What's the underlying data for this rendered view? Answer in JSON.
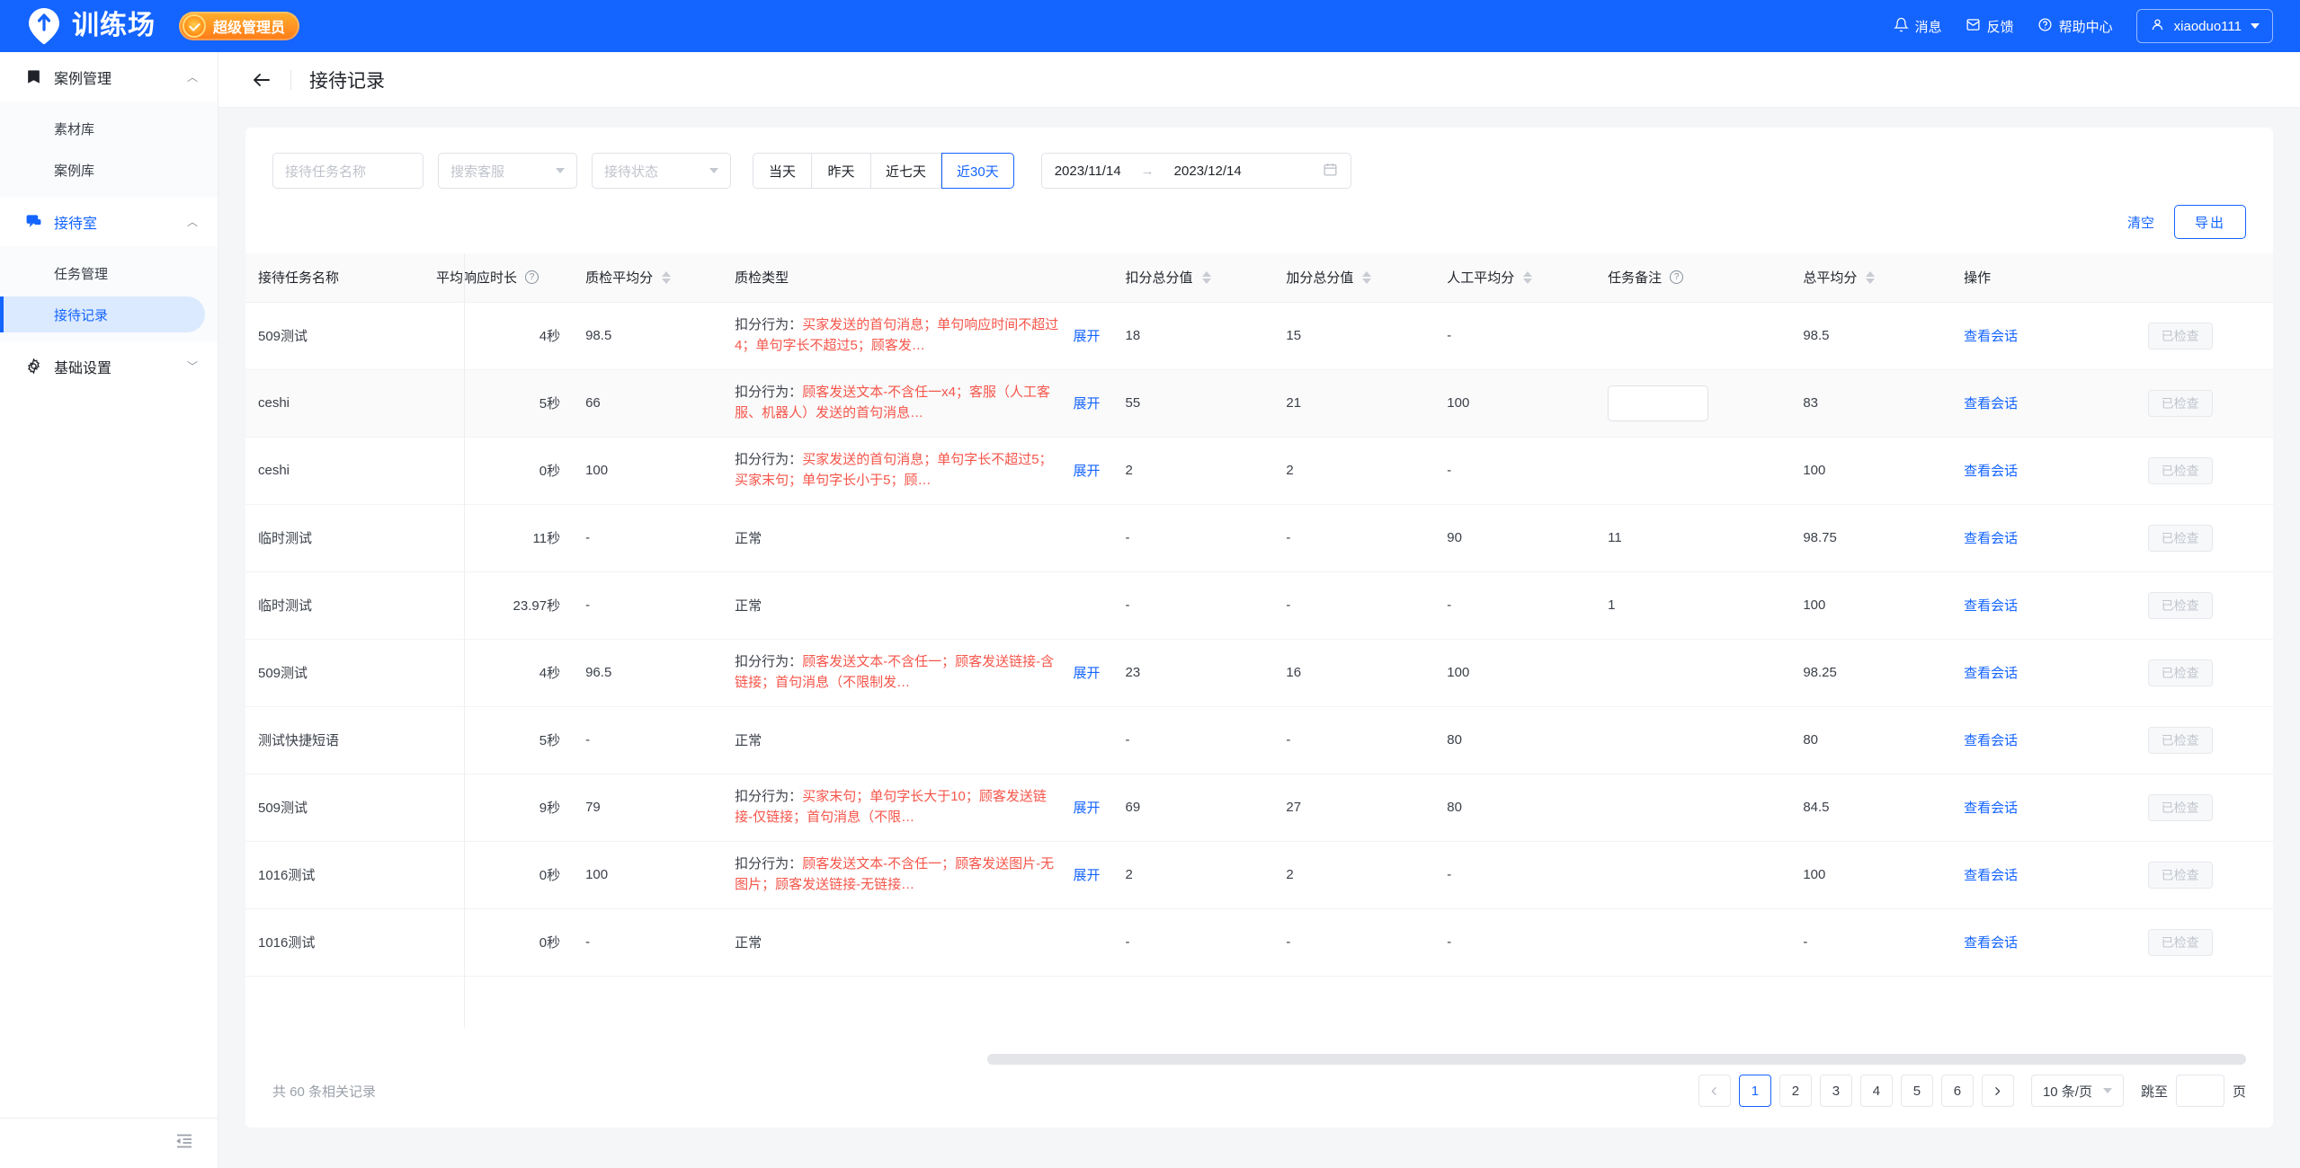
{
  "brand": {
    "name": "训练场",
    "badge_label": "超级管理员",
    "accent": "#1464ff"
  },
  "topnav": {
    "items": [
      {
        "label": "消息",
        "icon": "bell-icon"
      },
      {
        "label": "反馈",
        "icon": "feedback-icon"
      },
      {
        "label": "帮助中心",
        "icon": "help-circle-icon"
      }
    ],
    "user": "xiaoduo111"
  },
  "sidebar": {
    "groups": [
      {
        "label": "案例管理",
        "icon": "book-icon",
        "expanded": true,
        "active": false,
        "chevron": "︿",
        "items": [
          {
            "label": "素材库",
            "selected": false
          },
          {
            "label": "案例库",
            "selected": false
          }
        ]
      },
      {
        "label": "接待室",
        "icon": "chat-icon",
        "expanded": true,
        "active": true,
        "chevron": "︿",
        "items": [
          {
            "label": "任务管理",
            "selected": false
          },
          {
            "label": "接待记录",
            "selected": true
          }
        ]
      },
      {
        "label": "基础设置",
        "icon": "gear-icon",
        "expanded": false,
        "active": false,
        "chevron": "﹀",
        "items": []
      }
    ],
    "collapse_icon": "collapse-menu-icon"
  },
  "header": {
    "back_icon": "back-arrow-icon",
    "title": "接待记录"
  },
  "filters": {
    "task_name_placeholder": "接待任务名称",
    "task_name_value": "",
    "agent_select_placeholder": "搜索客服",
    "agent_select_value": "",
    "status_select_placeholder": "接待状态",
    "status_select_value": "",
    "quick_ranges": [
      {
        "label": "当天",
        "active": false
      },
      {
        "label": "昨天",
        "active": false
      },
      {
        "label": "近七天",
        "active": false
      },
      {
        "label": "近30天",
        "active": true
      }
    ],
    "date_start": "2023/11/14",
    "date_separator": "→",
    "date_end": "2023/12/14",
    "calendar_icon": "calendar-icon"
  },
  "actions": {
    "clear_label": "清空",
    "export_label": "导出"
  },
  "table": {
    "columns": [
      {
        "label": "接待任务名称",
        "sortable": false,
        "help": false
      },
      {
        "label": "平均响应时长",
        "sortable": false,
        "help": true
      },
      {
        "label": "质检平均分",
        "sortable": true,
        "help": false
      },
      {
        "label": "质检类型",
        "sortable": false,
        "help": false
      },
      {
        "label": "扣分总分值",
        "sortable": true,
        "help": false
      },
      {
        "label": "加分总分值",
        "sortable": true,
        "help": false
      },
      {
        "label": "人工平均分",
        "sortable": true,
        "help": false
      },
      {
        "label": "任务备注",
        "sortable": false,
        "help": true
      },
      {
        "label": "总平均分",
        "sortable": true,
        "help": false
      },
      {
        "label": "操作",
        "sortable": false,
        "help": false
      }
    ],
    "expand_label": "展开",
    "qc_prefix": "扣分行为：",
    "normal_label": "正常",
    "view_label": "查看会话",
    "checked_label": "已检查",
    "rows": [
      {
        "task": "509测试",
        "avg_resp": "4秒",
        "qc_avg": "98.5",
        "qc_type_kind": "deduct",
        "qc_detail": "买家发送的首句消息；单句响应时间不超过4；单句字长不超过5；顾客发…",
        "deduct_total": "18",
        "add_total": "15",
        "manual_avg": "-",
        "note": "",
        "note_input": false,
        "total_avg": "98.5",
        "alt": false
      },
      {
        "task": "ceshi",
        "avg_resp": "5秒",
        "qc_avg": "66",
        "qc_type_kind": "deduct",
        "qc_detail": "顾客发送文本-不含任一x4；客服（人工客服、机器人）发送的首句消息…",
        "deduct_total": "55",
        "add_total": "21",
        "manual_avg": "100",
        "note": "",
        "note_input": true,
        "total_avg": "83",
        "alt": true
      },
      {
        "task": "ceshi",
        "avg_resp": "0秒",
        "qc_avg": "100",
        "qc_type_kind": "deduct",
        "qc_detail": "买家发送的首句消息；单句字长不超过5；买家末句；单句字长小于5；顾…",
        "deduct_total": "2",
        "add_total": "2",
        "manual_avg": "-",
        "note": "",
        "note_input": false,
        "total_avg": "100",
        "alt": false
      },
      {
        "task": "临时测试",
        "avg_resp": "11秒",
        "qc_avg": "-",
        "qc_type_kind": "normal",
        "qc_detail": "",
        "deduct_total": "-",
        "add_total": "-",
        "manual_avg": "90",
        "note": "11",
        "note_input": false,
        "total_avg": "98.75",
        "alt": false
      },
      {
        "task": "临时测试",
        "avg_resp": "23.97秒",
        "qc_avg": "-",
        "qc_type_kind": "normal",
        "qc_detail": "",
        "deduct_total": "-",
        "add_total": "-",
        "manual_avg": "-",
        "note": "1",
        "note_input": false,
        "total_avg": "100",
        "alt": false
      },
      {
        "task": "509测试",
        "avg_resp": "4秒",
        "qc_avg": "96.5",
        "qc_type_kind": "deduct",
        "qc_detail": "顾客发送文本-不含任一；顾客发送链接-含链接；首句消息（不限制发…",
        "deduct_total": "23",
        "add_total": "16",
        "manual_avg": "100",
        "note": "",
        "note_input": false,
        "total_avg": "98.25",
        "alt": false
      },
      {
        "task": "测试快捷短语",
        "avg_resp": "5秒",
        "qc_avg": "-",
        "qc_type_kind": "normal",
        "qc_detail": "",
        "deduct_total": "-",
        "add_total": "-",
        "manual_avg": "80",
        "note": "",
        "note_input": false,
        "total_avg": "80",
        "alt": false
      },
      {
        "task": "509测试",
        "avg_resp": "9秒",
        "qc_avg": "79",
        "qc_type_kind": "deduct",
        "qc_detail": "买家末句；单句字长大于10；顾客发送链接-仅链接；首句消息（不限…",
        "deduct_total": "69",
        "add_total": "27",
        "manual_avg": "80",
        "note": "",
        "note_input": false,
        "total_avg": "84.5",
        "alt": false
      },
      {
        "task": "1016测试",
        "avg_resp": "0秒",
        "qc_avg": "100",
        "qc_type_kind": "deduct",
        "qc_detail": "顾客发送文本-不含任一；顾客发送图片-无图片；顾客发送链接-无链接…",
        "deduct_total": "2",
        "add_total": "2",
        "manual_avg": "-",
        "note": "",
        "note_input": false,
        "total_avg": "100",
        "alt": false
      },
      {
        "task": "1016测试",
        "avg_resp": "0秒",
        "qc_avg": "-",
        "qc_type_kind": "normal",
        "qc_detail": "",
        "deduct_total": "-",
        "add_total": "-",
        "manual_avg": "-",
        "note": "",
        "note_input": false,
        "total_avg": "-",
        "alt": false
      }
    ]
  },
  "footer": {
    "total_text": "共 60 条相关记录",
    "prev_icon": "chevron-left-icon",
    "next_icon": "chevron-right-icon",
    "pages": [
      "1",
      "2",
      "3",
      "4",
      "5",
      "6"
    ],
    "current_page": "1",
    "page_size_label": "10 条/页",
    "jump_label": "跳至",
    "jump_value": "",
    "jump_unit": "页"
  }
}
